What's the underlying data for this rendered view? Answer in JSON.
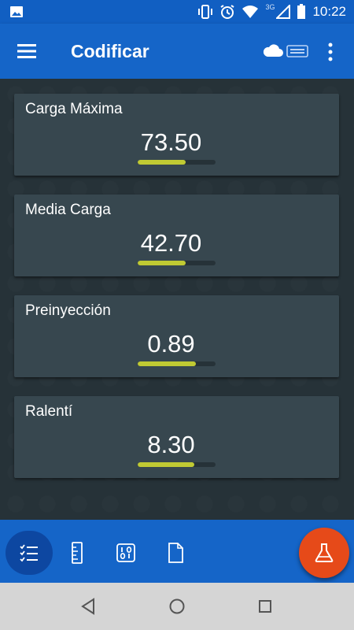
{
  "status_bar": {
    "time": "10:22",
    "network": "3G",
    "icons": [
      "image-icon",
      "vibrate-icon",
      "alarm-icon",
      "wifi-icon",
      "signal-icon",
      "battery-icon"
    ]
  },
  "app_bar": {
    "title": "Codificar",
    "icons": [
      "menu-icon",
      "cloud-icon",
      "obd-adapter-icon",
      "more-vert-icon"
    ]
  },
  "cards": [
    {
      "label": "Carga Máxima",
      "value": "73.50",
      "level": 0.62
    },
    {
      "label": "Media Carga",
      "value": "42.70",
      "level": 0.62
    },
    {
      "label": "Preinyección",
      "value": "0.89",
      "level": 0.75
    },
    {
      "label": "Ralentí",
      "value": "8.30",
      "level": 0.73
    }
  ],
  "bottom_nav": {
    "items": [
      "checklist-icon",
      "ruler-icon",
      "binary-icon",
      "document-icon"
    ],
    "active": "checklist-icon"
  },
  "fab": {
    "icon": "flask-icon"
  },
  "system_nav": [
    "back-icon",
    "home-icon",
    "recents-icon"
  ],
  "colors": {
    "app_bar": "#1565c8",
    "card_bg": "#37474f",
    "background": "#263238",
    "bar_fill": "#c0ca33",
    "fab": "#e64a19"
  }
}
